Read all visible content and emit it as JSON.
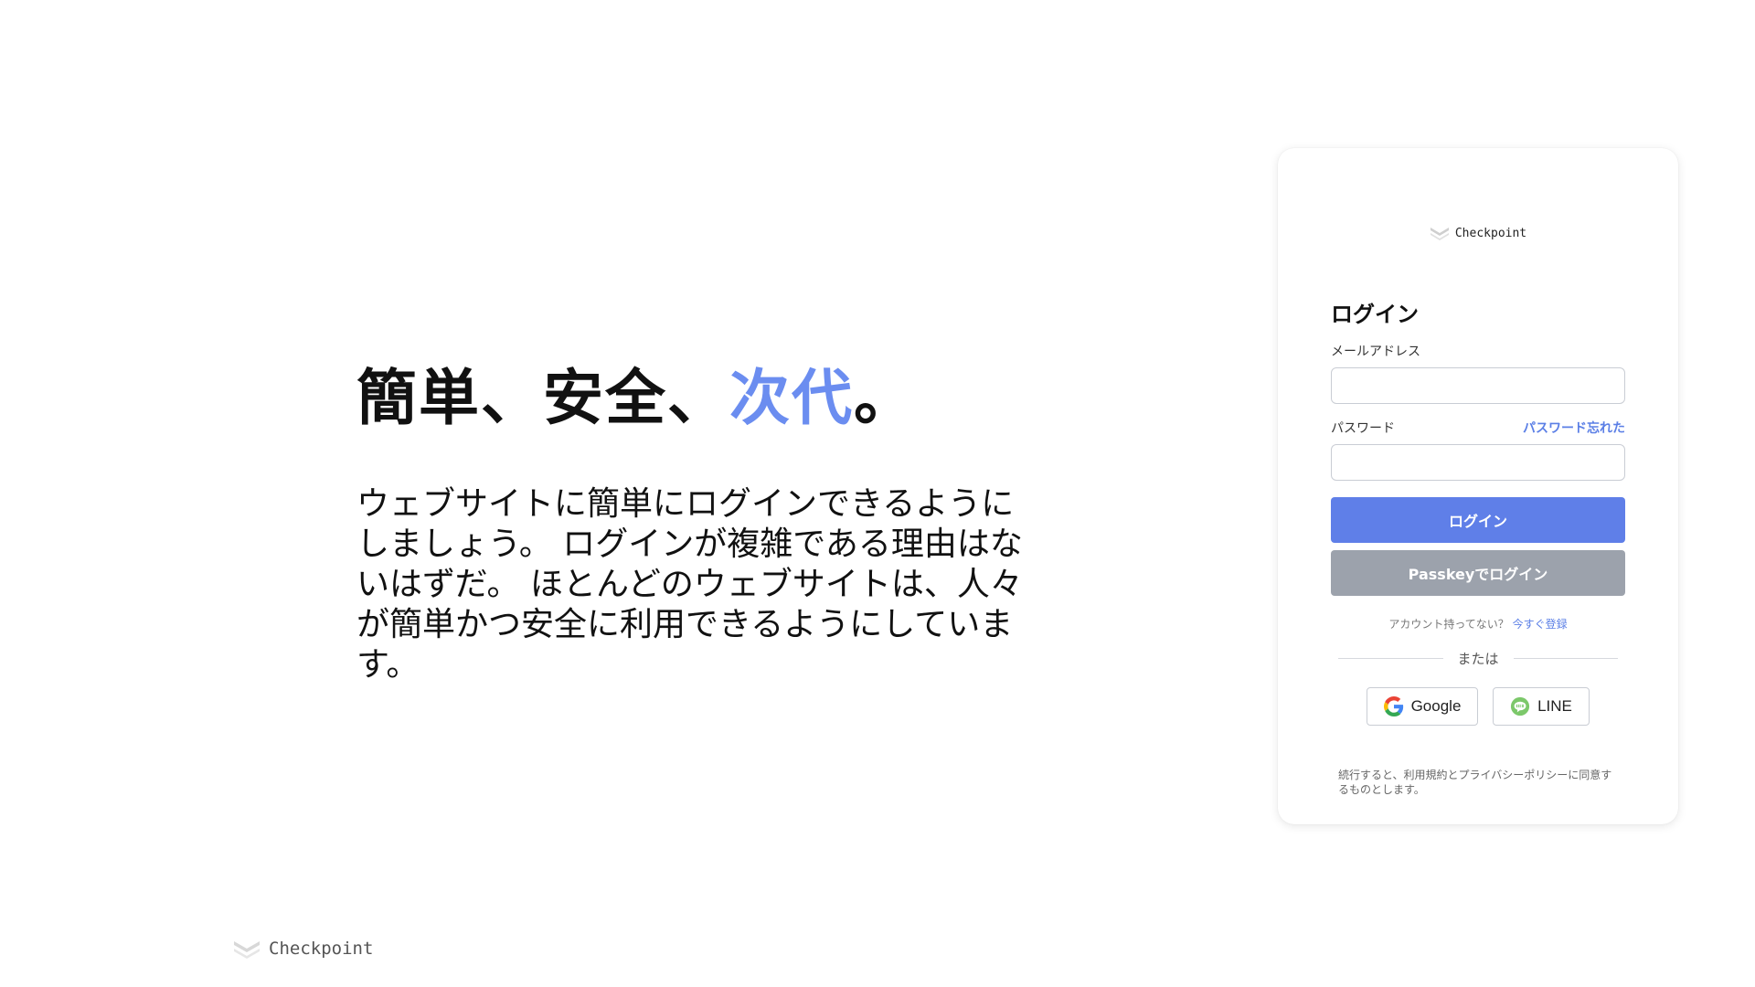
{
  "hero": {
    "title_part1": "簡単、安全、",
    "title_accent": "次代",
    "title_end": "。",
    "description": "ウェブサイトに簡単にログインできるようにしましょう。 ログインが複雑である理由はないはずだ。 ほとんどのウェブサイトは、人々が簡単かつ安全に利用できるようにしています。"
  },
  "brand": {
    "name": "Checkpoint",
    "icon": "checkpoint-logo-icon"
  },
  "login_card": {
    "title": "ログイン",
    "email_label": "メールアドレス",
    "email_value": "",
    "email_placeholder": "",
    "password_label": "パスワード",
    "password_value": "",
    "password_placeholder": "",
    "forgot_password": "パスワード忘れた",
    "login_button": "ログイン",
    "passkey_button": "Passkeyでログイン",
    "signup_prompt": "アカウント持ってない？",
    "signup_link": "今すぐ登録",
    "or_text": "または",
    "google_button": "Google",
    "line_button": "LINE",
    "terms": "続行すると、利用規約とプライバシーポリシーに同意するものとします。"
  },
  "colors": {
    "accent": "#6b8df0",
    "login_button": "#5f7fe8",
    "passkey_button": "#9ca2ac",
    "link": "#5b7fe6"
  }
}
